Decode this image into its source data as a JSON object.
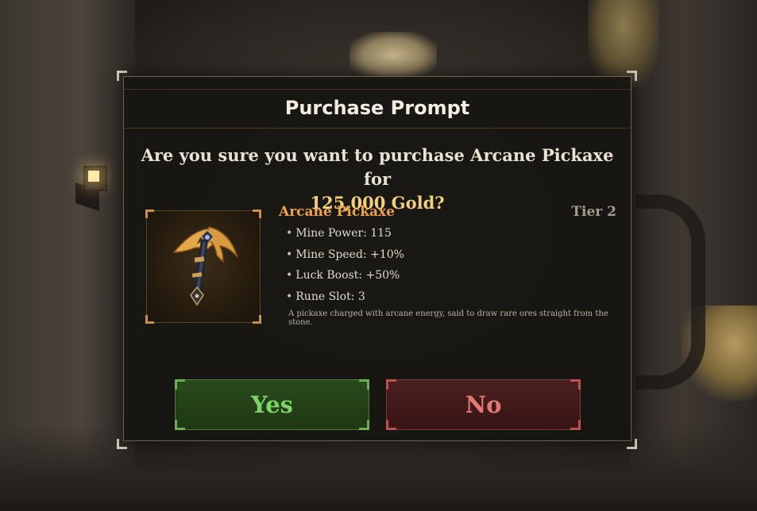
{
  "dialog": {
    "title": "Purchase Prompt",
    "question_prefix": "Are you sure you want to purchase Arcane Pickaxe for",
    "price": "125,000 Gold?"
  },
  "item": {
    "name": "Arcane Pickaxe",
    "tier": "Tier 2",
    "icon": "pickaxe-icon",
    "stats": [
      {
        "label": "Mine Power: 115"
      },
      {
        "label": "Mine Speed: +10%"
      },
      {
        "label": "Luck Boost: +50%"
      },
      {
        "label": "Rune Slot: 3"
      }
    ],
    "description": "A pickaxe charged with arcane energy, said to draw rare ores straight from the stone."
  },
  "buttons": {
    "yes_label": "Yes",
    "no_label": "No"
  },
  "colors": {
    "accent_gold": "#f3cf7c",
    "item_name": "#f0a24a",
    "yes_green": "#7fd36a",
    "no_red": "#e07a74"
  }
}
